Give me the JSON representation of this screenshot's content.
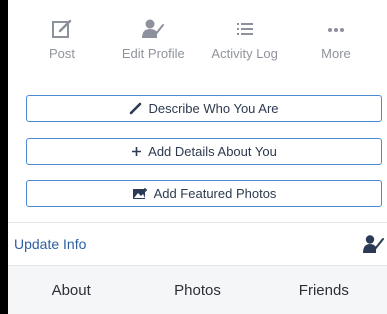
{
  "actions": {
    "post": "Post",
    "edit_profile": "Edit Profile",
    "activity_log": "Activity Log",
    "more": "More"
  },
  "buttons": {
    "describe": "Describe Who You Are",
    "add_details": "Add Details About You",
    "add_photos": "Add Featured Photos"
  },
  "update_info": {
    "label": "Update Info"
  },
  "tabs": [
    "About",
    "Photos",
    "Friends"
  ],
  "colors": {
    "accent": "#4b8bd6",
    "link": "#2d5fa3",
    "icon": "#8c919b",
    "dark_icon": "#2c3b55"
  },
  "icons": {
    "post": "pencil-square-icon",
    "edit_profile": "person-pencil-icon",
    "activity_log": "list-icon",
    "more": "ellipsis-icon",
    "describe": "pencil-icon",
    "add_details": "plus-icon",
    "add_photos": "photo-plus-icon",
    "update_info": "person-pencil-icon"
  }
}
